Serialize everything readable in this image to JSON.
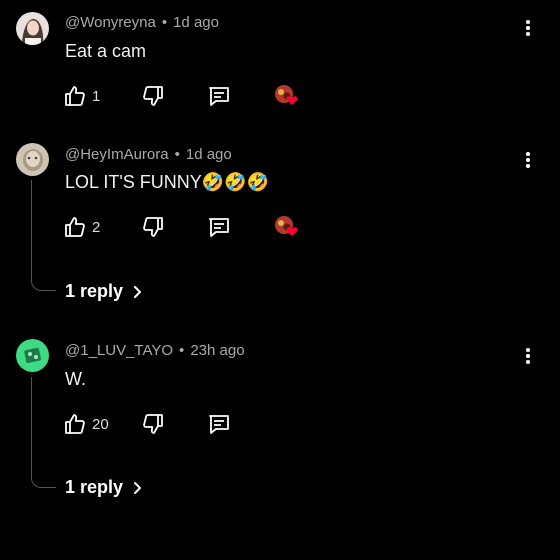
{
  "comments": [
    {
      "username": "@Wonyreyna",
      "time": "1d ago",
      "text": "Eat a  cam",
      "likes": "1",
      "has_heart": true,
      "replies": ""
    },
    {
      "username": "@HeyImAurora",
      "time": "1d ago",
      "text": "LOL IT'S FUNNY🤣🤣🤣",
      "likes": "2",
      "has_heart": true,
      "replies": "1 reply"
    },
    {
      "username": "@1_LUV_TAYO",
      "time": "23h ago",
      "text": "W.",
      "likes": "20",
      "has_heart": false,
      "replies": "1 reply"
    }
  ],
  "separator": "•",
  "colors": {
    "background": "#000000",
    "meta": "#aaaaaa",
    "heart": "#ff0033",
    "avatar_green": "#3ddc84"
  },
  "icons": [
    "thumbs-up-icon",
    "thumbs-down-icon",
    "reply-comment-icon",
    "creator-heart-icon",
    "more-vert-icon",
    "chevron-right-icon"
  ]
}
